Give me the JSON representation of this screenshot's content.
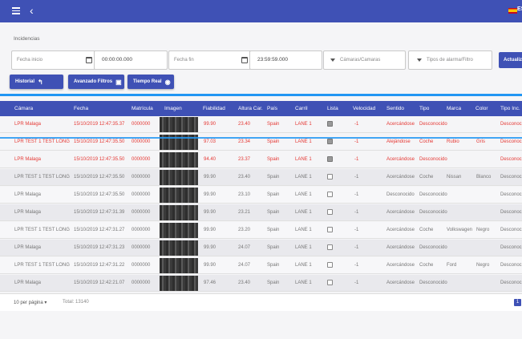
{
  "topbar": {
    "back_glyph": "‹",
    "lang_code": "ES",
    "flag": "spain-flag"
  },
  "filters": {
    "section_title": "Incidencias",
    "from_date": {
      "label": "Fecha inicio",
      "time": "00:00:00.000"
    },
    "to_date": {
      "label": "Fecha fin",
      "time": "23:59:59.000"
    },
    "cameras_placeholder": "Cámaras/Camaras",
    "alarm_types_placeholder": "Tipos de alarma/Filtro",
    "update_label": "Actualizar"
  },
  "toolbar": {
    "history_label": "Historial",
    "history_icon": "↰",
    "advanced_label": "Avanzado Filtros",
    "advanced_icon": "▣",
    "realtime_label": "Tiempo Real",
    "realtime_icon": "◉"
  },
  "table": {
    "headers": [
      "Cámara",
      "Fecha",
      "Matrícula",
      "Imagen",
      "Fiabilidad",
      "Altura Car.",
      "País",
      "Carril",
      "Lista",
      "Velocidad",
      "Sentido",
      "Tipo",
      "Marca",
      "Color",
      "Tipo Inc."
    ],
    "rows": [
      {
        "style": "alarm",
        "camera": "LPR Malaga",
        "date": "15/10/2019 12:47:35.37",
        "plate": "0000000",
        "reliability": "99.90",
        "height": "23.40",
        "country": "Spain",
        "lane": "LANE 1",
        "checked": true,
        "speed": "-1",
        "direction": "Acercándose",
        "type": "Desconocido",
        "brand": "",
        "color": "",
        "incident": "Desconocido"
      },
      {
        "style": "alarm",
        "camera": "LPR TEST 1 TEST LONG",
        "date": "15/10/2019 12:47:35.50",
        "plate": "0000000",
        "reliability": "97.03",
        "height": "23.34",
        "country": "Spain",
        "lane": "LANE 1",
        "checked": true,
        "speed": "-1",
        "direction": "Alejándose",
        "type": "Coche",
        "brand": "Rubio",
        "color": "Gris",
        "incident": "Desconocido"
      },
      {
        "style": "alarm",
        "camera": "LPR Malaga",
        "date": "15/10/2019 12:47:35.50",
        "plate": "0000000",
        "reliability": "94.40",
        "height": "23.37",
        "country": "Spain",
        "lane": "LANE 1",
        "checked": true,
        "speed": "-1",
        "direction": "Acercándose",
        "type": "Desconocido",
        "brand": "",
        "color": "",
        "incident": "Desconocido"
      },
      {
        "style": "odd",
        "camera": "LPR TEST 1 TEST LONG",
        "date": "15/10/2019 12:47:35.50",
        "plate": "0000000",
        "reliability": "99.90",
        "height": "23.40",
        "country": "Spain",
        "lane": "LANE 1",
        "checked": false,
        "speed": "-1",
        "direction": "Acercándose",
        "type": "Coche",
        "brand": "Nissan",
        "color": "Blanco",
        "incident": "Desconocido"
      },
      {
        "style": "even",
        "camera": "LPR Malaga",
        "date": "15/10/2019 12:47:35.50",
        "plate": "0000000",
        "reliability": "99.90",
        "height": "23.10",
        "country": "Spain",
        "lane": "LANE 1",
        "checked": false,
        "speed": "-1",
        "direction": "Desconocido",
        "type": "Desconocido",
        "brand": "",
        "color": "",
        "incident": "Desconocido"
      },
      {
        "style": "odd",
        "camera": "LPR Malaga",
        "date": "15/10/2019 12:47:31.39",
        "plate": "0000000",
        "reliability": "99.90",
        "height": "23.21",
        "country": "Spain",
        "lane": "LANE 1",
        "checked": false,
        "speed": "-1",
        "direction": "Acercándose",
        "type": "Desconocido",
        "brand": "",
        "color": "",
        "incident": "Desconocido"
      },
      {
        "style": "even",
        "camera": "LPR TEST 1 TEST LONG",
        "date": "15/10/2019 12:47:31.27",
        "plate": "0000000",
        "reliability": "99.90",
        "height": "23.20",
        "country": "Spain",
        "lane": "LANE 1",
        "checked": false,
        "speed": "-1",
        "direction": "Acercándose",
        "type": "Coche",
        "brand": "Volkswagen",
        "color": "Negro",
        "incident": "Desconocido"
      },
      {
        "style": "odd",
        "camera": "LPR Malaga",
        "date": "15/10/2019 12:47:31.23",
        "plate": "0000000",
        "reliability": "99.90",
        "height": "24.07",
        "country": "Spain",
        "lane": "LANE 1",
        "checked": false,
        "speed": "-1",
        "direction": "Acercándose",
        "type": "Desconocido",
        "brand": "",
        "color": "",
        "incident": "Desconocido"
      },
      {
        "style": "even",
        "camera": "LPR TEST 1 TEST LONG",
        "date": "15/10/2019 12:47:31.22",
        "plate": "0000000",
        "reliability": "99.90",
        "height": "24.07",
        "country": "Spain",
        "lane": "LANE 1",
        "checked": false,
        "speed": "-1",
        "direction": "Acercándose",
        "type": "Coche",
        "brand": "Ford",
        "color": "Negro",
        "incident": "Desconocido"
      },
      {
        "style": "odd",
        "camera": "LPR Malaga",
        "date": "15/10/2019 12:42:21.07",
        "plate": "0000000",
        "reliability": "97.46",
        "height": "23.40",
        "country": "Spain",
        "lane": "LANE 1",
        "checked": false,
        "speed": "-1",
        "direction": "Acercándose",
        "type": "Desconocido",
        "brand": "",
        "color": "",
        "incident": "Desconocido"
      }
    ]
  },
  "pagination": {
    "per_page_label": "10 per página ▾",
    "total_label": "Total: 13140",
    "page": "1"
  },
  "colors": {
    "primary": "#3f51b5",
    "alarm_text": "#e53935",
    "highlight_line": "#2196f3"
  }
}
